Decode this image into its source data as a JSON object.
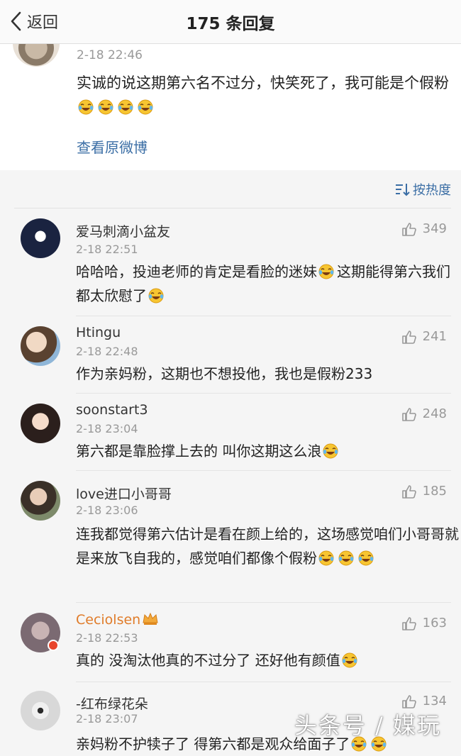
{
  "nav": {
    "back_label": "返回",
    "title": "175 条回复"
  },
  "original": {
    "time": "2-18 22:46",
    "text": "实诚的说这期第六名不过分，快笑死了，我可能是个假粉",
    "emoji_count": 4,
    "view_link": "查看原微博"
  },
  "sort": {
    "label": "按热度"
  },
  "comments": [
    {
      "name": "爱马刺滴小盆友",
      "time": "2-18 22:51",
      "likes": "349",
      "text_a": "哈哈哈，投迪老师的肯定是看脸的迷妹",
      "text_b": "这期能得第六我们都太欣慰了"
    },
    {
      "name": "Htingu",
      "time": "2-18 22:48",
      "likes": "241",
      "text": "作为亲妈粉，这期也不想投他，我也是假粉233"
    },
    {
      "name": "soonstart3",
      "time": "2-18 23:04",
      "likes": "248",
      "text": "第六都是靠脸撑上去的 叫你这期这么浪"
    },
    {
      "name": "love进口小哥哥",
      "time": "2-18 23:06",
      "likes": "185",
      "text": "连我都觉得第六估计是看在颜上给的，这场感觉咱们小哥哥就是来放飞自我的，感觉咱们都像个假粉"
    },
    {
      "name": "Ceciolsen",
      "time": "2-18 22:53",
      "likes": "163",
      "text": "真的 没淘汰他真的不过分了 还好他有颜值"
    },
    {
      "name": "-红布绿花朵",
      "time": "2-18 23:07",
      "likes": "134",
      "text": "亲妈粉不护犊子了 得第六都是观众给面子了"
    }
  ],
  "watermark": "头条号 / 媒玩",
  "colors": {
    "link": "#3b6ea5",
    "vip_name": "#e07c2a",
    "text": "#222222",
    "meta": "#999999"
  }
}
